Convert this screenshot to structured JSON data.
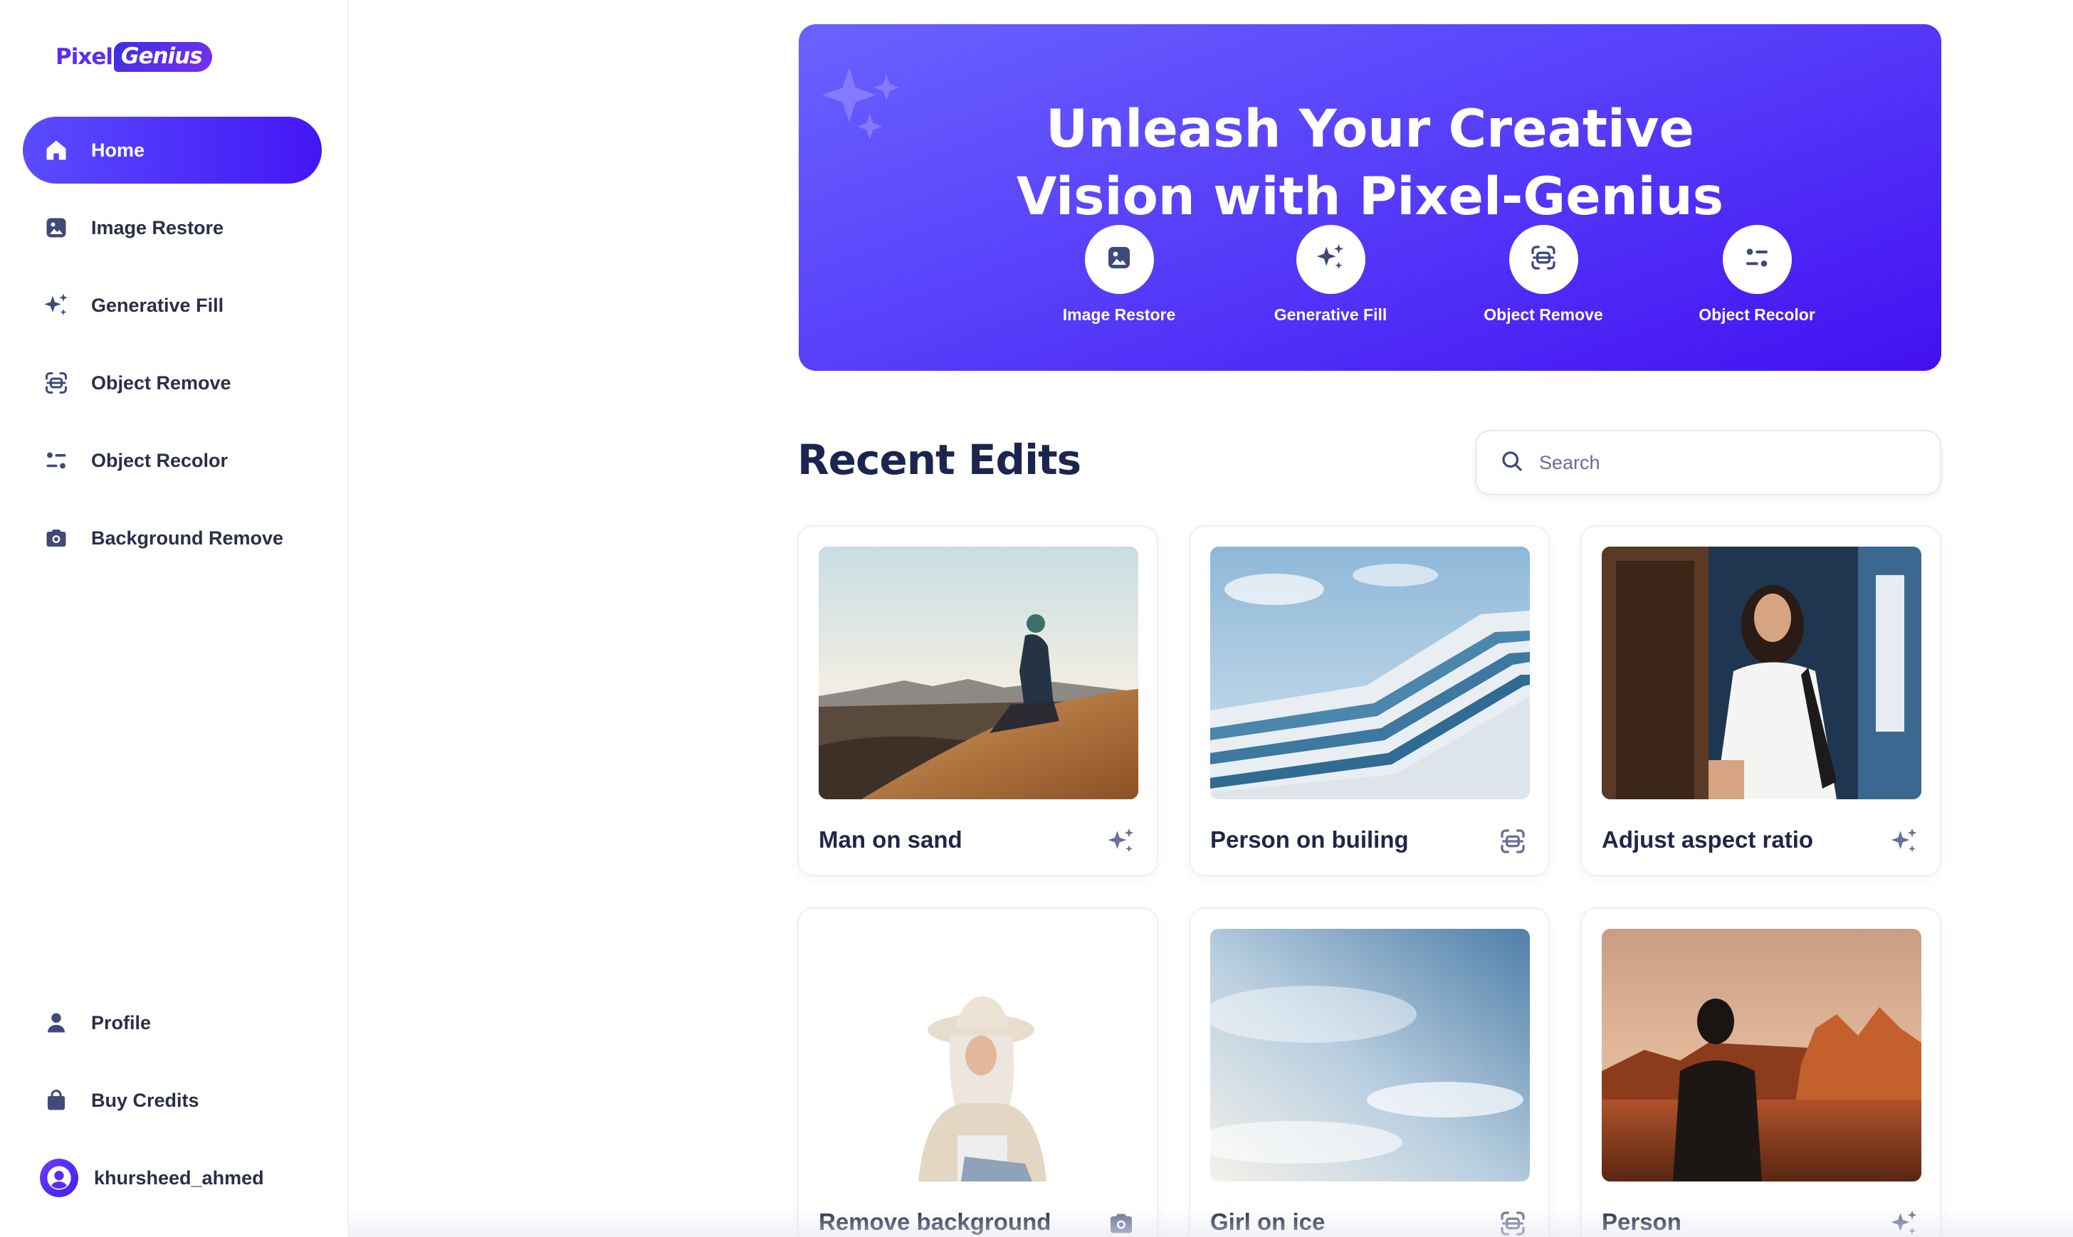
{
  "brand": {
    "logo_part1": "Pixel",
    "logo_part2": "Genius",
    "accent": "#4a22f5"
  },
  "sidebar": {
    "items": [
      {
        "label": "Home",
        "icon": "home-icon",
        "active": true
      },
      {
        "label": "Image Restore",
        "icon": "image-icon"
      },
      {
        "label": "Generative Fill",
        "icon": "sparkles-icon"
      },
      {
        "label": "Object Remove",
        "icon": "scan-icon"
      },
      {
        "label": "Object Recolor",
        "icon": "recolor-icon"
      },
      {
        "label": "Background Remove",
        "icon": "camera-icon"
      }
    ],
    "bottom": [
      {
        "label": "Profile",
        "icon": "user-icon"
      },
      {
        "label": "Buy Credits",
        "icon": "bag-icon"
      }
    ],
    "user": {
      "name": "khursheed_ahmed",
      "icon": "avatar-icon"
    }
  },
  "hero": {
    "title_line1": "Unleash Your Creative",
    "title_line2": "Vision with Pixel-Genius",
    "tools": [
      {
        "label": "Image Restore",
        "icon": "image-icon"
      },
      {
        "label": "Generative Fill",
        "icon": "sparkles-icon"
      },
      {
        "label": "Object Remove",
        "icon": "scan-icon"
      },
      {
        "label": "Object Recolor",
        "icon": "recolor-icon"
      }
    ]
  },
  "recent": {
    "title": "Recent Edits",
    "search_placeholder": "Search",
    "cards": [
      {
        "title": "Man on sand",
        "icon": "sparkles-icon"
      },
      {
        "title": "Person on builing",
        "icon": "scan-icon"
      },
      {
        "title": "Adjust aspect ratio",
        "icon": "sparkles-icon"
      },
      {
        "title": "Remove background",
        "icon": "camera-icon"
      },
      {
        "title": "Girl on ice",
        "icon": "scan-icon"
      },
      {
        "title": "Person",
        "icon": "sparkles-icon"
      }
    ]
  }
}
